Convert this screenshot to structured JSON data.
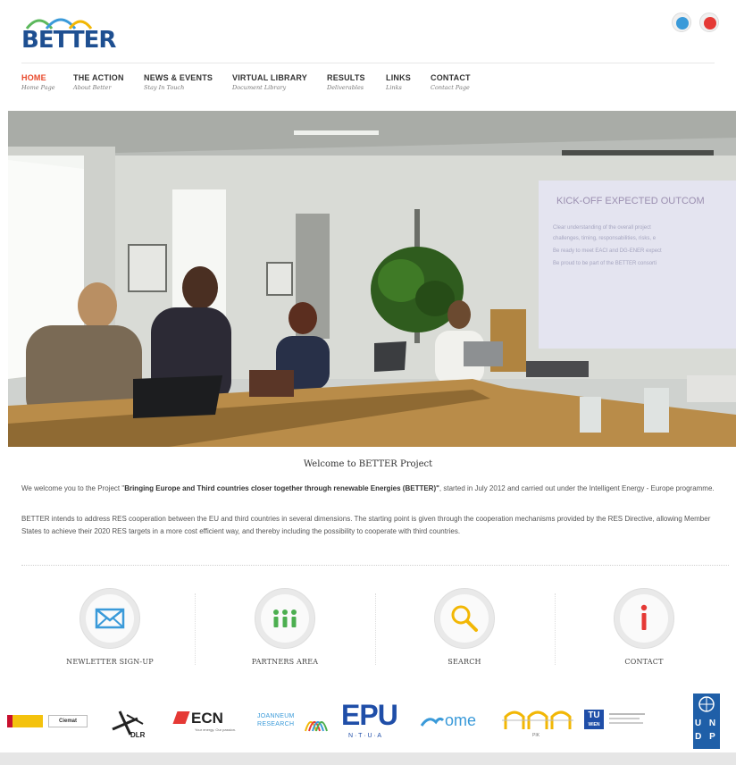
{
  "site": {
    "logo_text": "BETTER"
  },
  "nav": [
    {
      "label": "HOME",
      "sub": "Home Page"
    },
    {
      "label": "THE ACTION",
      "sub": "About Better"
    },
    {
      "label": "NEWS & EVENTS",
      "sub": "Stay In Touch"
    },
    {
      "label": "VIRTUAL LIBRARY",
      "sub": "Document Library"
    },
    {
      "label": "RESULTS",
      "sub": "Deliverables"
    },
    {
      "label": "LINKS",
      "sub": "Links"
    },
    {
      "label": "CONTACT",
      "sub": "Contact Page"
    }
  ],
  "hero": {
    "slide_title": "KICK-OFF EXPECTED OUTCOM",
    "slide_lines": [
      "Clear understanding of the overall project",
      "challenges, timing, responsabilities, risks, e",
      "Be ready to meet EACI and DG-ENER expect",
      "Be proud to be part of the BETTER consorti"
    ]
  },
  "welcome": {
    "title": "Welcome to BETTER Project",
    "p1_a": "We welcome you to the Project \"",
    "p1_bold": "Bringing Europe and Third countries closer together through renewable Energies (BETTER)\"",
    "p1_b": ", started in July 2012 and carried out under the Intelligent Energy - Europe programme.",
    "p2": "BETTER intends to address RES cooperation between the EU and third countries in several dimensions. The starting point is given through the cooperation mechanisms provided by the RES Directive, allowing Member States to achieve their 2020 RES targets in a more cost efficient way, and thereby including the possibility to cooperate with third countries."
  },
  "features": [
    {
      "label": "NEWLETTER SIGN-UP",
      "icon": "envelope-icon"
    },
    {
      "label": "PARTNERS AREA",
      "icon": "people-icon"
    },
    {
      "label": "SEARCH",
      "icon": "magnifier-icon"
    },
    {
      "label": "CONTACT",
      "icon": "info-icon"
    }
  ],
  "partners": {
    "ciemat": "Ciemat",
    "dlr": "DLR",
    "ecn": "ECN",
    "ecn_tag": "Your energy. Our passion.",
    "joanneum_1": "JOANNEUM",
    "joanneum_2": "RESEARCH",
    "epu": "EPU",
    "epu_sub": "N · T · U · A",
    "ome": "ome",
    "pik": "PIK",
    "tu": "TU",
    "tu_sub": "WIEN",
    "undp_1": "U N",
    "undp_2": "D P"
  },
  "colors": {
    "accent": "#e8482a",
    "logo_blue": "#1e4f91",
    "icon_blue": "#3a9ad9",
    "icon_green": "#4caf50",
    "icon_yellow": "#f2b705",
    "icon_red": "#e53935",
    "undp_blue": "#1f5fa8"
  }
}
